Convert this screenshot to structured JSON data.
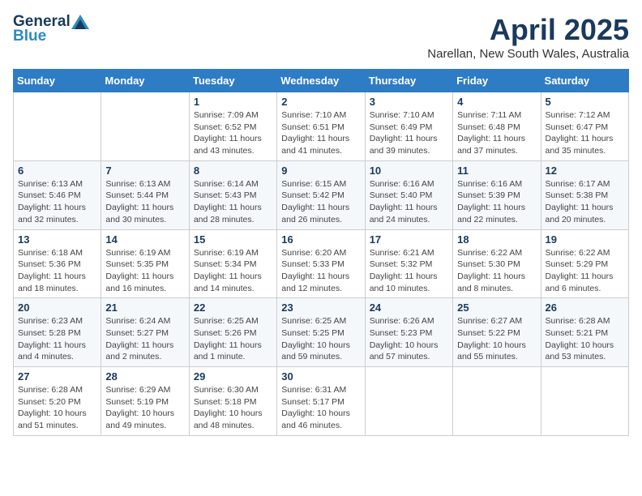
{
  "header": {
    "logo_general": "General",
    "logo_blue": "Blue",
    "title": "April 2025",
    "subtitle": "Narellan, New South Wales, Australia"
  },
  "weekdays": [
    "Sunday",
    "Monday",
    "Tuesday",
    "Wednesday",
    "Thursday",
    "Friday",
    "Saturday"
  ],
  "weeks": [
    [
      {
        "day": "",
        "sunrise": "",
        "sunset": "",
        "daylight": ""
      },
      {
        "day": "",
        "sunrise": "",
        "sunset": "",
        "daylight": ""
      },
      {
        "day": "1",
        "sunrise": "Sunrise: 7:09 AM",
        "sunset": "Sunset: 6:52 PM",
        "daylight": "Daylight: 11 hours and 43 minutes."
      },
      {
        "day": "2",
        "sunrise": "Sunrise: 7:10 AM",
        "sunset": "Sunset: 6:51 PM",
        "daylight": "Daylight: 11 hours and 41 minutes."
      },
      {
        "day": "3",
        "sunrise": "Sunrise: 7:10 AM",
        "sunset": "Sunset: 6:49 PM",
        "daylight": "Daylight: 11 hours and 39 minutes."
      },
      {
        "day": "4",
        "sunrise": "Sunrise: 7:11 AM",
        "sunset": "Sunset: 6:48 PM",
        "daylight": "Daylight: 11 hours and 37 minutes."
      },
      {
        "day": "5",
        "sunrise": "Sunrise: 7:12 AM",
        "sunset": "Sunset: 6:47 PM",
        "daylight": "Daylight: 11 hours and 35 minutes."
      }
    ],
    [
      {
        "day": "6",
        "sunrise": "Sunrise: 6:13 AM",
        "sunset": "Sunset: 5:46 PM",
        "daylight": "Daylight: 11 hours and 32 minutes."
      },
      {
        "day": "7",
        "sunrise": "Sunrise: 6:13 AM",
        "sunset": "Sunset: 5:44 PM",
        "daylight": "Daylight: 11 hours and 30 minutes."
      },
      {
        "day": "8",
        "sunrise": "Sunrise: 6:14 AM",
        "sunset": "Sunset: 5:43 PM",
        "daylight": "Daylight: 11 hours and 28 minutes."
      },
      {
        "day": "9",
        "sunrise": "Sunrise: 6:15 AM",
        "sunset": "Sunset: 5:42 PM",
        "daylight": "Daylight: 11 hours and 26 minutes."
      },
      {
        "day": "10",
        "sunrise": "Sunrise: 6:16 AM",
        "sunset": "Sunset: 5:40 PM",
        "daylight": "Daylight: 11 hours and 24 minutes."
      },
      {
        "day": "11",
        "sunrise": "Sunrise: 6:16 AM",
        "sunset": "Sunset: 5:39 PM",
        "daylight": "Daylight: 11 hours and 22 minutes."
      },
      {
        "day": "12",
        "sunrise": "Sunrise: 6:17 AM",
        "sunset": "Sunset: 5:38 PM",
        "daylight": "Daylight: 11 hours and 20 minutes."
      }
    ],
    [
      {
        "day": "13",
        "sunrise": "Sunrise: 6:18 AM",
        "sunset": "Sunset: 5:36 PM",
        "daylight": "Daylight: 11 hours and 18 minutes."
      },
      {
        "day": "14",
        "sunrise": "Sunrise: 6:19 AM",
        "sunset": "Sunset: 5:35 PM",
        "daylight": "Daylight: 11 hours and 16 minutes."
      },
      {
        "day": "15",
        "sunrise": "Sunrise: 6:19 AM",
        "sunset": "Sunset: 5:34 PM",
        "daylight": "Daylight: 11 hours and 14 minutes."
      },
      {
        "day": "16",
        "sunrise": "Sunrise: 6:20 AM",
        "sunset": "Sunset: 5:33 PM",
        "daylight": "Daylight: 11 hours and 12 minutes."
      },
      {
        "day": "17",
        "sunrise": "Sunrise: 6:21 AM",
        "sunset": "Sunset: 5:32 PM",
        "daylight": "Daylight: 11 hours and 10 minutes."
      },
      {
        "day": "18",
        "sunrise": "Sunrise: 6:22 AM",
        "sunset": "Sunset: 5:30 PM",
        "daylight": "Daylight: 11 hours and 8 minutes."
      },
      {
        "day": "19",
        "sunrise": "Sunrise: 6:22 AM",
        "sunset": "Sunset: 5:29 PM",
        "daylight": "Daylight: 11 hours and 6 minutes."
      }
    ],
    [
      {
        "day": "20",
        "sunrise": "Sunrise: 6:23 AM",
        "sunset": "Sunset: 5:28 PM",
        "daylight": "Daylight: 11 hours and 4 minutes."
      },
      {
        "day": "21",
        "sunrise": "Sunrise: 6:24 AM",
        "sunset": "Sunset: 5:27 PM",
        "daylight": "Daylight: 11 hours and 2 minutes."
      },
      {
        "day": "22",
        "sunrise": "Sunrise: 6:25 AM",
        "sunset": "Sunset: 5:26 PM",
        "daylight": "Daylight: 11 hours and 1 minute."
      },
      {
        "day": "23",
        "sunrise": "Sunrise: 6:25 AM",
        "sunset": "Sunset: 5:25 PM",
        "daylight": "Daylight: 10 hours and 59 minutes."
      },
      {
        "day": "24",
        "sunrise": "Sunrise: 6:26 AM",
        "sunset": "Sunset: 5:23 PM",
        "daylight": "Daylight: 10 hours and 57 minutes."
      },
      {
        "day": "25",
        "sunrise": "Sunrise: 6:27 AM",
        "sunset": "Sunset: 5:22 PM",
        "daylight": "Daylight: 10 hours and 55 minutes."
      },
      {
        "day": "26",
        "sunrise": "Sunrise: 6:28 AM",
        "sunset": "Sunset: 5:21 PM",
        "daylight": "Daylight: 10 hours and 53 minutes."
      }
    ],
    [
      {
        "day": "27",
        "sunrise": "Sunrise: 6:28 AM",
        "sunset": "Sunset: 5:20 PM",
        "daylight": "Daylight: 10 hours and 51 minutes."
      },
      {
        "day": "28",
        "sunrise": "Sunrise: 6:29 AM",
        "sunset": "Sunset: 5:19 PM",
        "daylight": "Daylight: 10 hours and 49 minutes."
      },
      {
        "day": "29",
        "sunrise": "Sunrise: 6:30 AM",
        "sunset": "Sunset: 5:18 PM",
        "daylight": "Daylight: 10 hours and 48 minutes."
      },
      {
        "day": "30",
        "sunrise": "Sunrise: 6:31 AM",
        "sunset": "Sunset: 5:17 PM",
        "daylight": "Daylight: 10 hours and 46 minutes."
      },
      {
        "day": "",
        "sunrise": "",
        "sunset": "",
        "daylight": ""
      },
      {
        "day": "",
        "sunrise": "",
        "sunset": "",
        "daylight": ""
      },
      {
        "day": "",
        "sunrise": "",
        "sunset": "",
        "daylight": ""
      }
    ]
  ]
}
